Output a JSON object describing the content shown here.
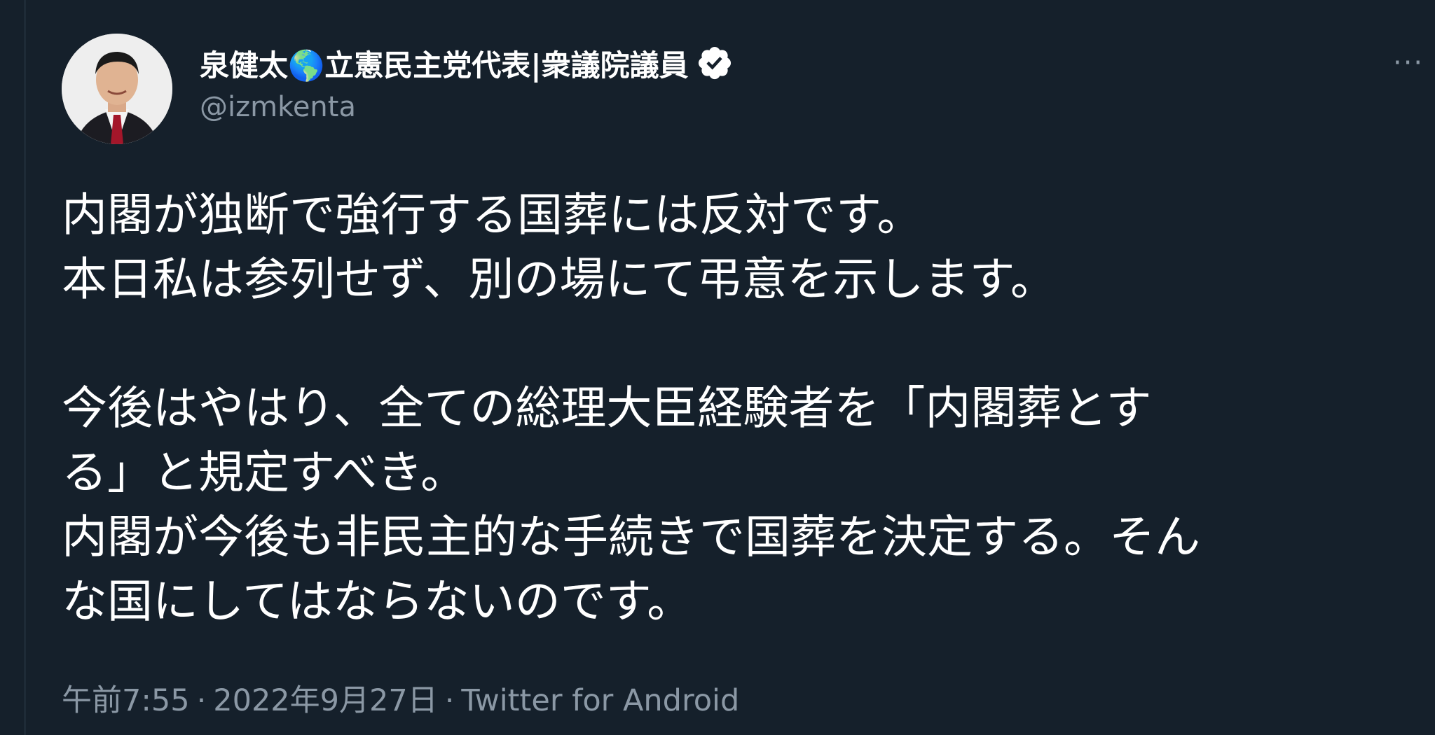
{
  "tweet": {
    "author": {
      "display_name": "泉健太🌎立憲民主党代表|衆議院議員",
      "handle": "@izmkenta",
      "verified": true,
      "avatar_icon": "profile-photo"
    },
    "more_label": "···",
    "text_lines": [
      "内閣が独断で強行する国葬には反対です。",
      "本日私は参列せず、別の場にて弔意を示します。",
      "",
      "今後はやはり、全ての総理大臣経験者を「内閣葬とす",
      "る」と規定すべき。",
      "内閣が今後も非民主的な手続きで国葬を決定する。そん",
      "な国にしてはならないのです。"
    ],
    "time": "午前7:55",
    "date": "2022年9月27日",
    "source": "Twitter for Android",
    "separator": "·"
  },
  "colors": {
    "background": "#15202b",
    "text": "#ffffff",
    "secondary_text": "#8b98a5"
  }
}
